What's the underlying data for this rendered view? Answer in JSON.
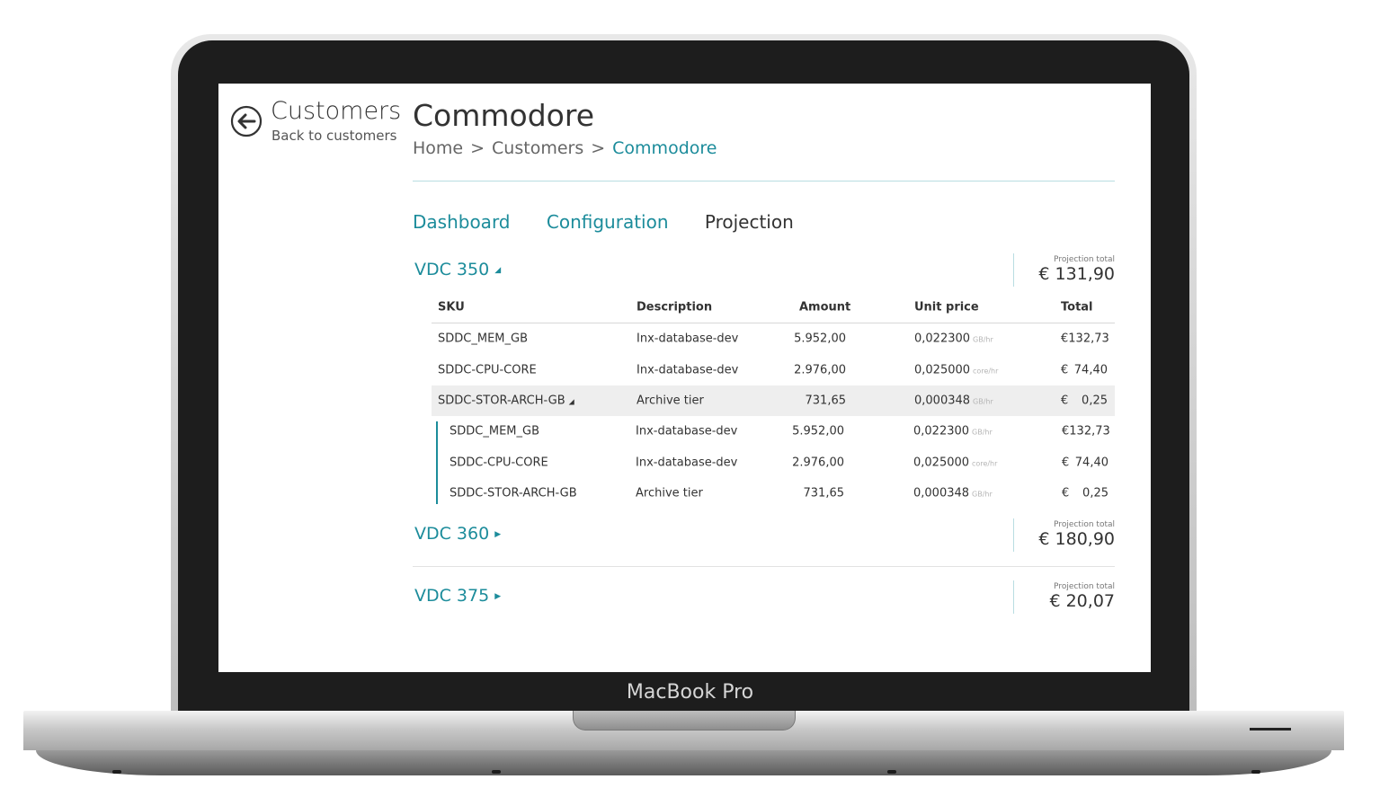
{
  "device": {
    "label": "MacBook Pro"
  },
  "back": {
    "title": "Customers",
    "subtitle": "Back to customers",
    "icon": "arrow-left-circle-icon"
  },
  "page": {
    "title": "Commodore"
  },
  "breadcrumb": {
    "items": [
      "Home",
      "Customers",
      "Commodore"
    ],
    "separator": ">"
  },
  "tabs": [
    {
      "label": "Dashboard",
      "active": false
    },
    {
      "label": "Configuration",
      "active": false
    },
    {
      "label": "Projection",
      "active": true
    }
  ],
  "vdcs": [
    {
      "name": "VDC 350",
      "expanded": true,
      "total_label": "Projection total",
      "total": "€ 131,90"
    },
    {
      "name": "VDC 360",
      "expanded": false,
      "total_label": "Projection total",
      "total": "€ 180,90"
    },
    {
      "name": "VDC 375",
      "expanded": false,
      "total_label": "Projection total",
      "total": "€ 20,07"
    }
  ],
  "table": {
    "headers": {
      "sku": "SKU",
      "description": "Description",
      "amount": "Amount",
      "unit_price": "Unit price",
      "total": "Total"
    },
    "rows": [
      {
        "sku": "SDDC_MEM_GB",
        "description": "Inx-database-dev",
        "amount": "5.952,00",
        "unit_price": "0,022300",
        "unit": "GB/hr",
        "currency": "€",
        "total": "132,73"
      },
      {
        "sku": "SDDC-CPU-CORE",
        "description": "Inx-database-dev",
        "amount": "2.976,00",
        "unit_price": "0,025000",
        "unit": "core/hr",
        "currency": "€",
        "total": "74,40"
      },
      {
        "sku": "SDDC-STOR-ARCH-GB",
        "description": "Archive tier",
        "amount": "731,65",
        "unit_price": "0,000348",
        "unit": "GB/hr",
        "currency": "€",
        "total": "0,25"
      }
    ],
    "sub_rows": [
      {
        "sku": "SDDC_MEM_GB",
        "description": "Inx-database-dev",
        "amount": "5.952,00",
        "unit_price": "0,022300",
        "unit": "GB/hr",
        "currency": "€",
        "total": "132,73"
      },
      {
        "sku": "SDDC-CPU-CORE",
        "description": "Inx-database-dev",
        "amount": "2.976,00",
        "unit_price": "0,025000",
        "unit": "core/hr",
        "currency": "€",
        "total": "74,40"
      },
      {
        "sku": "SDDC-STOR-ARCH-GB",
        "description": "Archive tier",
        "amount": "731,65",
        "unit_price": "0,000348",
        "unit": "GB/hr",
        "currency": "€",
        "total": "0,25"
      }
    ]
  },
  "colors": {
    "accent": "#1c8c9b",
    "text": "#333333",
    "selected_row": "#eeeeee"
  }
}
